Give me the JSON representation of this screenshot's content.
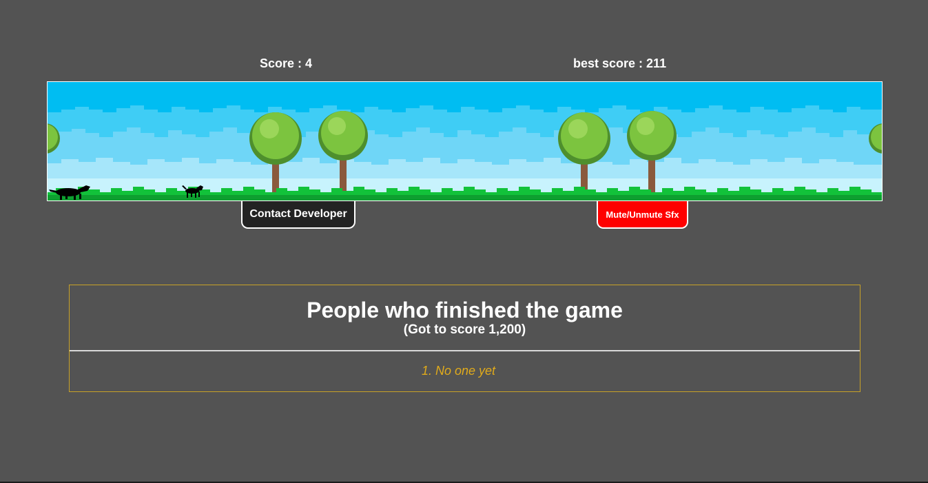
{
  "hud": {
    "score_text": "Score : 4",
    "best_text": "best score : 211"
  },
  "game": {
    "sky_color": "#00bdf2",
    "grass_color": "#12c23a",
    "tree_foliage_color": "#7cc43f",
    "trunk_color": "#8a5a3c",
    "characters": [
      "wolf-silhouette",
      "dog-silhouette"
    ]
  },
  "buttons": {
    "contact_label": "Contact Developer",
    "mute_label": "Mute/Unmute Sfx",
    "contact_color": "#232323",
    "mute_color": "#fe0000"
  },
  "leaderboard": {
    "title": "People who finished the game",
    "subtitle": "(Got to score 1,200)",
    "entries": [
      "1. No one yet"
    ],
    "border_color": "#c9a227",
    "entry_color": "#e1ab1b"
  }
}
